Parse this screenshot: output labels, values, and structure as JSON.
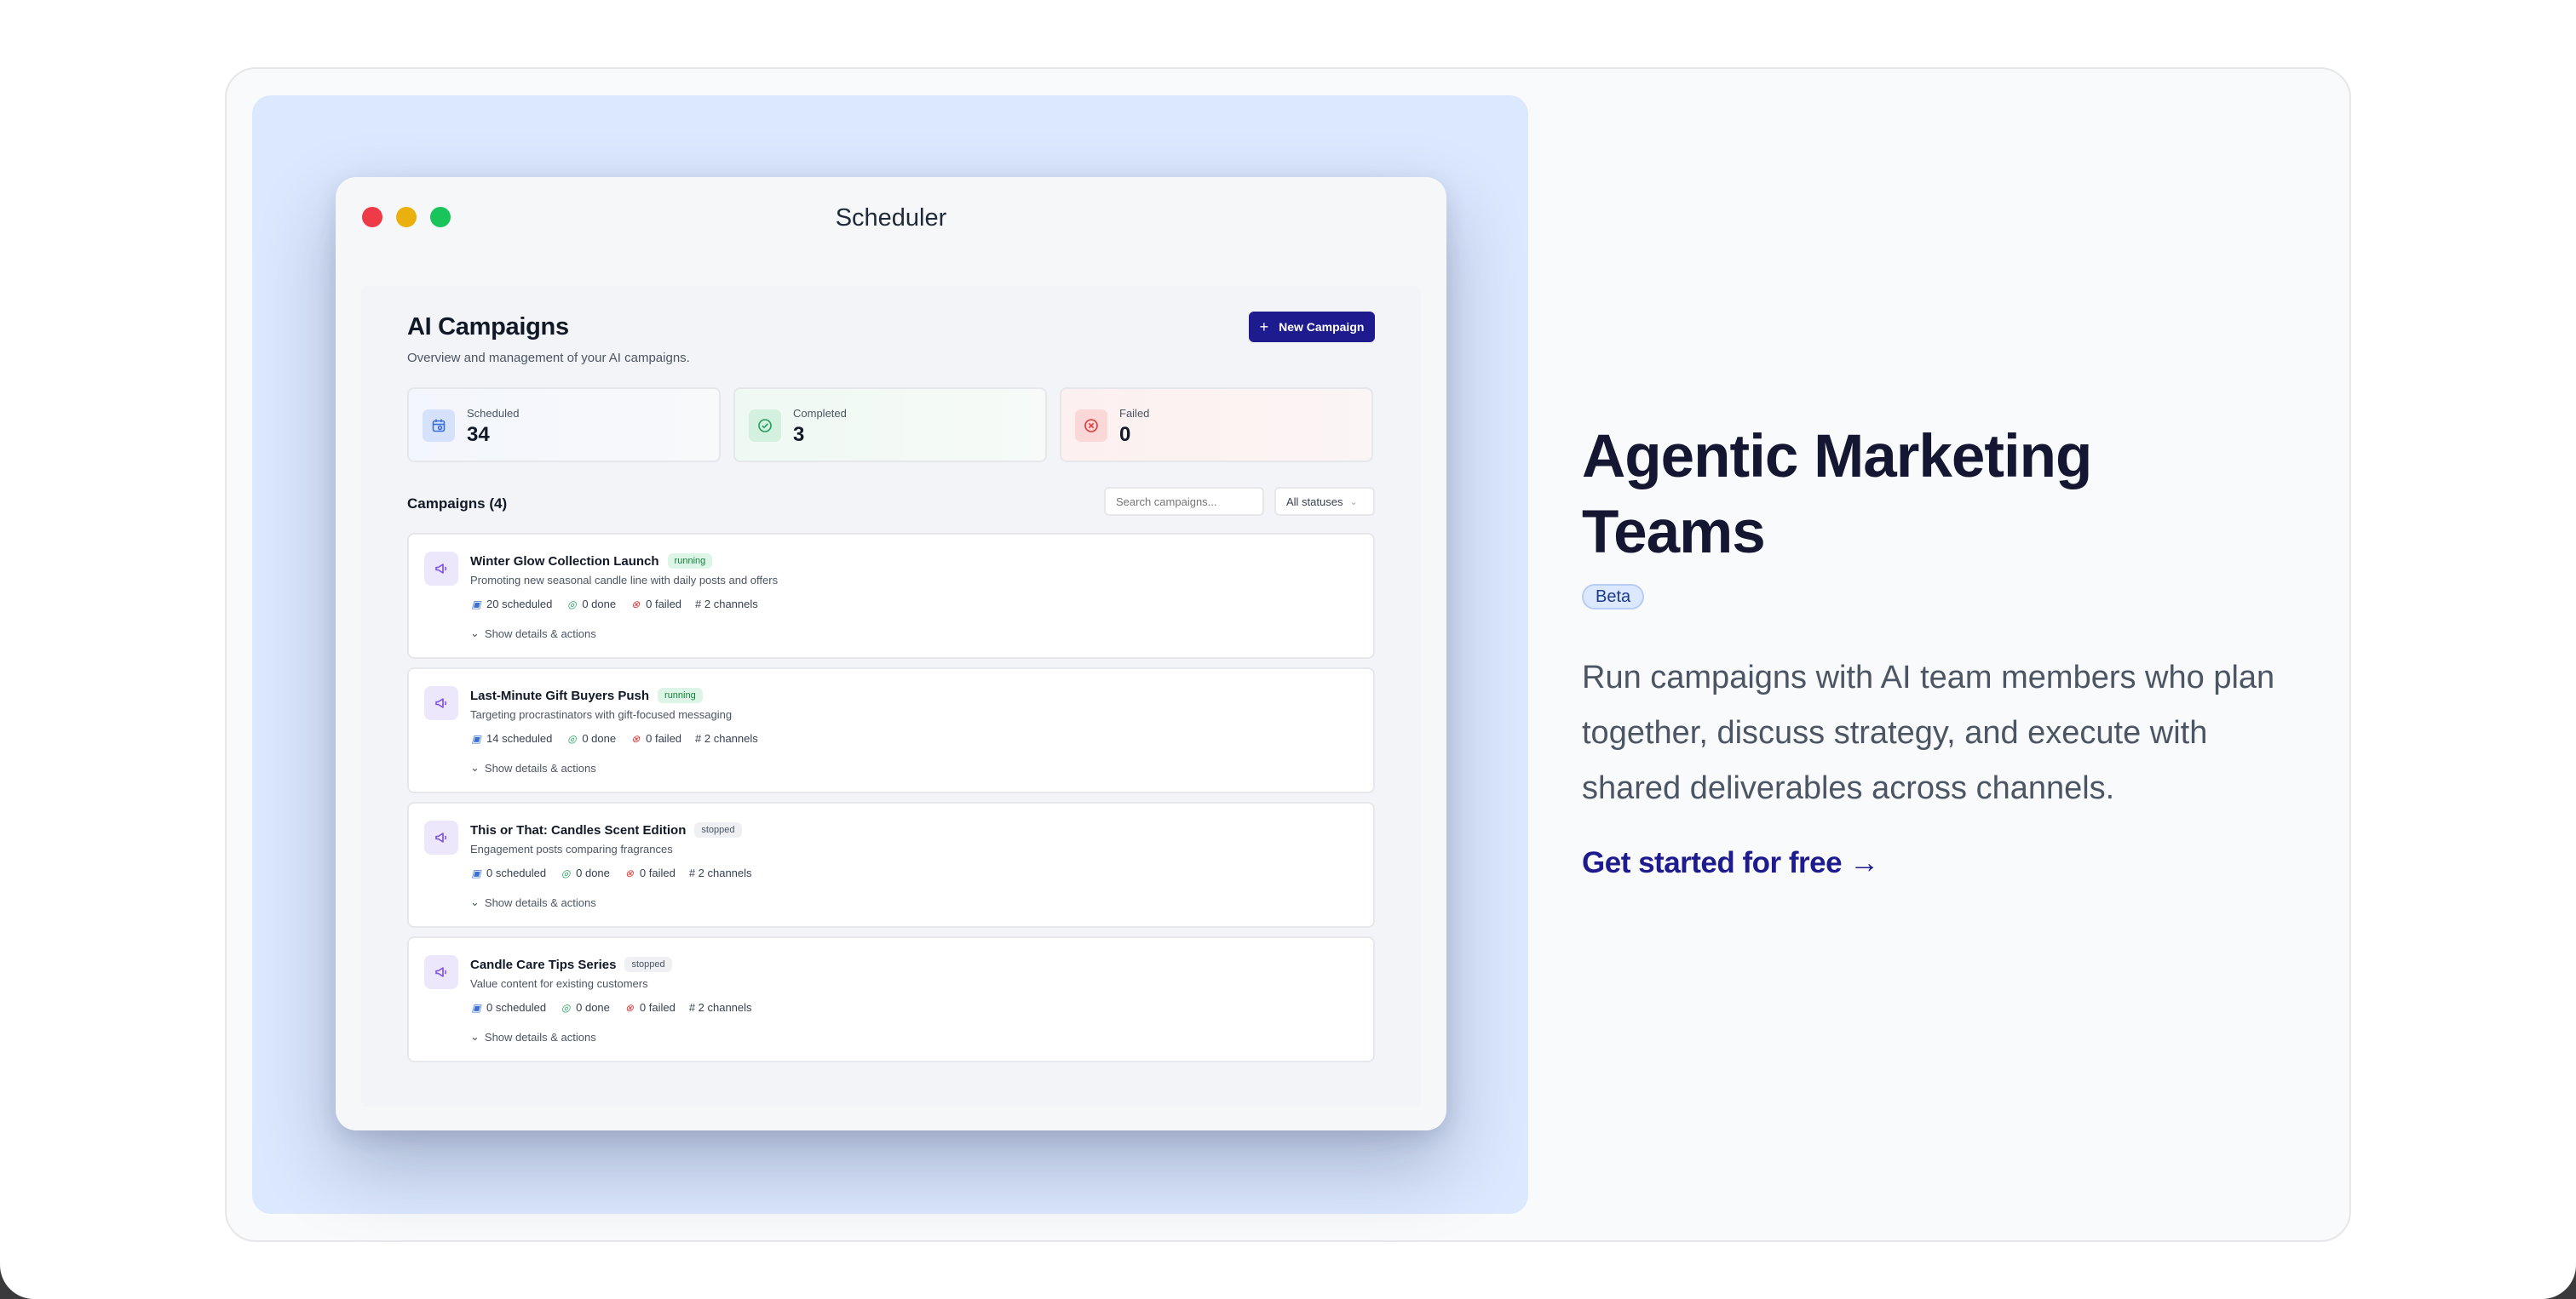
{
  "window": {
    "title": "Scheduler"
  },
  "app": {
    "title": "AI Campaigns",
    "subtitle": "Overview and management of your AI campaigns.",
    "new_button": "New Campaign"
  },
  "stats": [
    {
      "label": "Scheduled",
      "value": "34",
      "icon": "calendar-icon"
    },
    {
      "label": "Completed",
      "value": "3",
      "icon": "check-circle-icon"
    },
    {
      "label": "Failed",
      "value": "0",
      "icon": "x-circle-icon"
    }
  ],
  "campaigns_header": "Campaigns (4)",
  "search": {
    "placeholder": "Search campaigns..."
  },
  "status_filter": {
    "selected": "All statuses"
  },
  "campaigns": [
    {
      "title": "Winter Glow Collection Launch",
      "status": "running",
      "desc": "Promoting new seasonal candle line with daily posts and offers",
      "scheduled": "20 scheduled",
      "done": "0 done",
      "failed": "0 failed",
      "channels": "# 2 channels",
      "details": "Show details & actions"
    },
    {
      "title": "Last-Minute Gift Buyers Push",
      "status": "running",
      "desc": "Targeting procrastinators with gift-focused messaging",
      "scheduled": "14 scheduled",
      "done": "0 done",
      "failed": "0 failed",
      "channels": "# 2 channels",
      "details": "Show details & actions"
    },
    {
      "title": "This or That: Candles Scent Edition",
      "status": "stopped",
      "desc": "Engagement posts comparing fragrances",
      "scheduled": "0 scheduled",
      "done": "0 done",
      "failed": "0 failed",
      "channels": "# 2 channels",
      "details": "Show details & actions"
    },
    {
      "title": "Candle Care Tips Series",
      "status": "stopped",
      "desc": "Value content for existing customers",
      "scheduled": "0 scheduled",
      "done": "0 done",
      "failed": "0 failed",
      "channels": "# 2 channels",
      "details": "Show details & actions"
    }
  ],
  "hero": {
    "title": "Agentic Marketing Teams",
    "badge": "Beta",
    "body": "Run campaigns with AI team members who plan together, discuss strategy, and execute with shared deliverables across channels.",
    "cta": "Get started for free →"
  },
  "colors": {
    "accent": "#1e1b8f",
    "panel": "#dbe8fe",
    "running": "#15803d",
    "failed": "#dc3b3b"
  }
}
